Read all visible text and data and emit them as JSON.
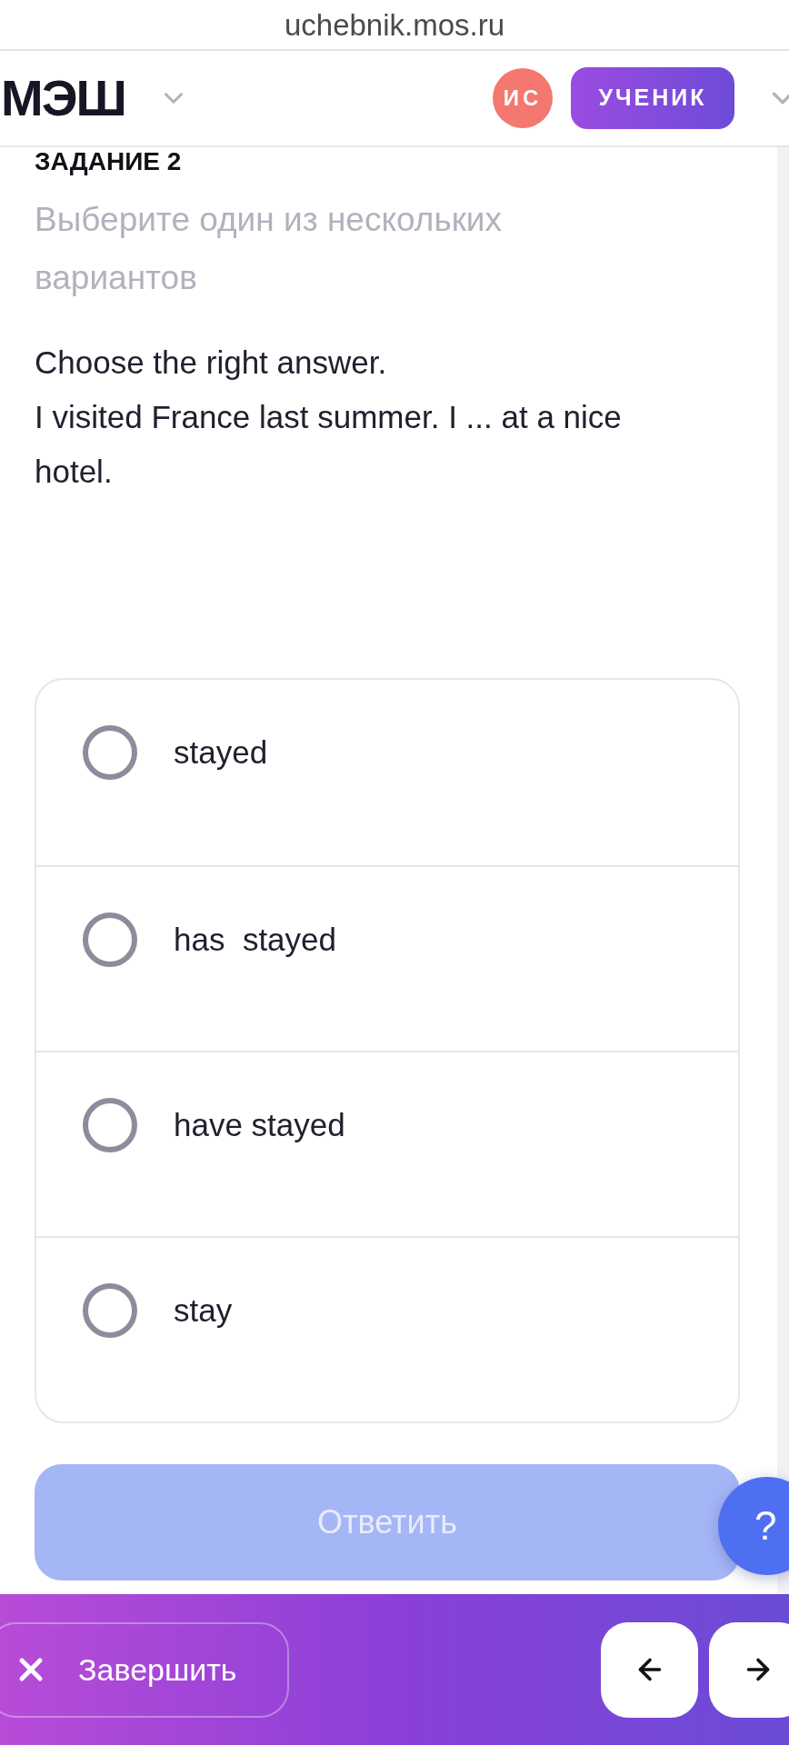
{
  "browser": {
    "url": "uchebnik.mos.ru"
  },
  "header": {
    "logo": "МЭШ",
    "avatar_initials": "ИС",
    "role": "УЧЕНИК"
  },
  "task": {
    "title": "ЗАДАНИЕ 2",
    "instruction": "Выберите один из нескольких вариантов",
    "question": [
      "Choose the right answer.",
      "I visited France last summer. I ... at a nice hotel."
    ]
  },
  "options": [
    {
      "label": "stayed",
      "selected": false
    },
    {
      "label": "has  stayed",
      "selected": false
    },
    {
      "label": "have stayed",
      "selected": false
    },
    {
      "label": "stay",
      "selected": false
    }
  ],
  "submit_button": {
    "label": "Ответить",
    "disabled": true
  },
  "help_button": {
    "label": "?"
  },
  "footer": {
    "finish_button": "Завершить"
  }
}
